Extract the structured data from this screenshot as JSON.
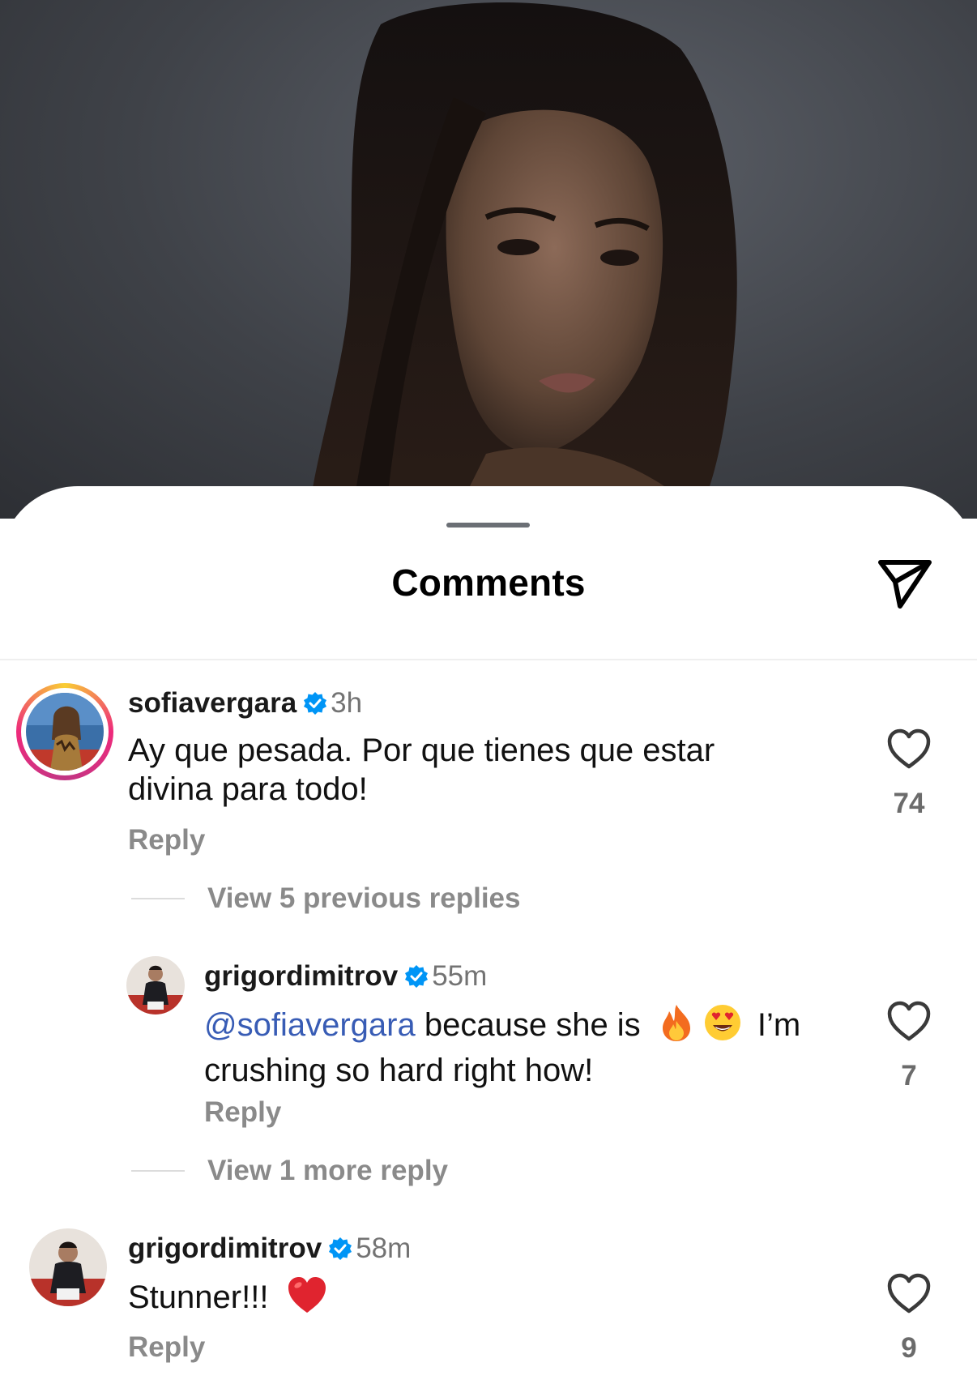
{
  "sheet": {
    "title": "Comments",
    "share_icon": "paper-plane-icon"
  },
  "comments": [
    {
      "username": "sofiavergara",
      "verified": true,
      "time": "3h",
      "text": "Ay que pesada. Por que tienes que estar divina para todo!",
      "reply_label": "Reply",
      "likes": "74",
      "view_replies": "View 5 previous replies",
      "story_ring": true
    },
    {
      "username": "grigordimitrov",
      "verified": true,
      "time": "55m",
      "mention": "@sofiavergara",
      "text_before_emoji": " because she is",
      "emojis": [
        "fire-emoji",
        "heart-eyes-emoji"
      ],
      "text_after_emoji": " I’m",
      "text_line2": "crushing so hard right how!",
      "reply_label": "Reply",
      "likes": "7",
      "view_replies": "View 1 more reply"
    },
    {
      "username": "grigordimitrov",
      "verified": true,
      "time": "58m",
      "text": "Stunner!!!",
      "emojis": [
        "red-heart-emoji"
      ],
      "reply_label": "Reply",
      "likes": "9"
    }
  ],
  "colors": {
    "verified": "#0095f6",
    "mention": "#385cb5",
    "secondary_text": "#737373"
  }
}
